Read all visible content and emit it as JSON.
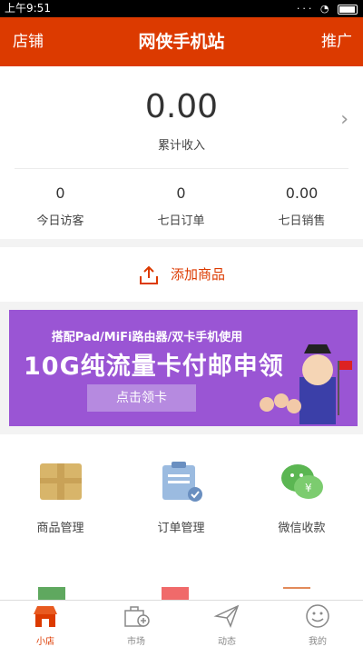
{
  "status_bar": {
    "time": "上午9:51"
  },
  "header": {
    "left_label": "店铺",
    "title": "网侠手机站",
    "right_label": "推广"
  },
  "income": {
    "value": "0.00",
    "label": "累计收入"
  },
  "stats": [
    {
      "value": "0",
      "label": "今日访客"
    },
    {
      "value": "0",
      "label": "七日订单"
    },
    {
      "value": "0.00",
      "label": "七日销售"
    }
  ],
  "add_product": {
    "label": "添加商品"
  },
  "banner": {
    "line1": "搭配Pad/MiFi路由器/双卡手机使用",
    "line2": "10G纯流量卡付邮申领",
    "button": "点击领卡"
  },
  "grid": [
    {
      "label": "商品管理",
      "icon": "box-icon"
    },
    {
      "label": "订单管理",
      "icon": "order-icon"
    },
    {
      "label": "微信收款",
      "icon": "wechat-icon"
    }
  ],
  "tabs": [
    {
      "label": "小店",
      "icon": "shop-icon",
      "active": true
    },
    {
      "label": "市场",
      "icon": "market-icon"
    },
    {
      "label": "动态",
      "icon": "send-icon"
    },
    {
      "label": "我的",
      "icon": "smile-icon"
    }
  ],
  "colors": {
    "accent": "#dc3a00",
    "banner_bg": "#9a55d4"
  }
}
